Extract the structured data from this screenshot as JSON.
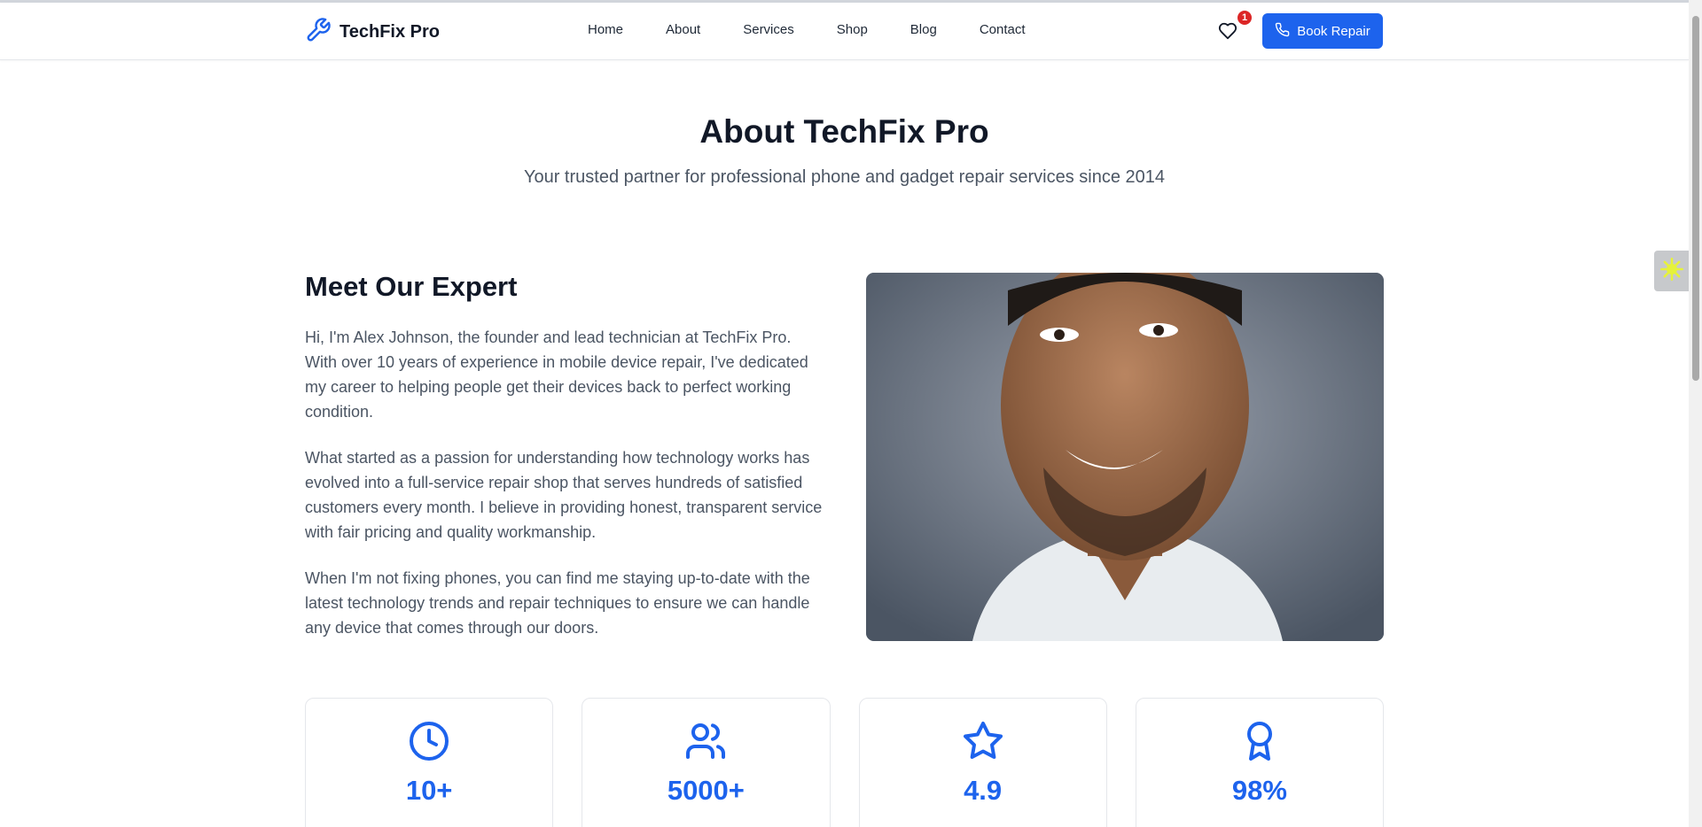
{
  "header": {
    "brand": "TechFix Pro",
    "nav": [
      "Home",
      "About",
      "Services",
      "Shop",
      "Blog",
      "Contact"
    ],
    "wishlist_count": "1",
    "book_button": "Book Repair"
  },
  "hero": {
    "title": "About TechFix Pro",
    "subtitle": "Your trusted partner for professional phone and gadget repair services since 2014"
  },
  "expert": {
    "title": "Meet Our Expert",
    "paragraphs": [
      "Hi, I'm Alex Johnson, the founder and lead technician at TechFix Pro. With over 10 years of experience in mobile device repair, I've dedicated my career to helping people get their devices back to perfect working condition.",
      "What started as a passion for understanding how technology works has evolved into a full-service repair shop that serves hundreds of satisfied customers every month. I believe in providing honest, transparent service with fair pricing and quality workmanship.",
      "When I'm not fixing phones, you can find me staying up-to-date with the latest technology trends and repair techniques to ensure we can handle any device that comes through our doors."
    ]
  },
  "stats": [
    {
      "icon": "clock-icon",
      "value": "10+"
    },
    {
      "icon": "users-icon",
      "value": "5000+"
    },
    {
      "icon": "star-icon",
      "value": "4.9"
    },
    {
      "icon": "award-icon",
      "value": "98%"
    }
  ],
  "colors": {
    "accent": "#1d63ed",
    "badge": "#dc2626",
    "heading": "#111827",
    "body_text": "#4b5563"
  }
}
